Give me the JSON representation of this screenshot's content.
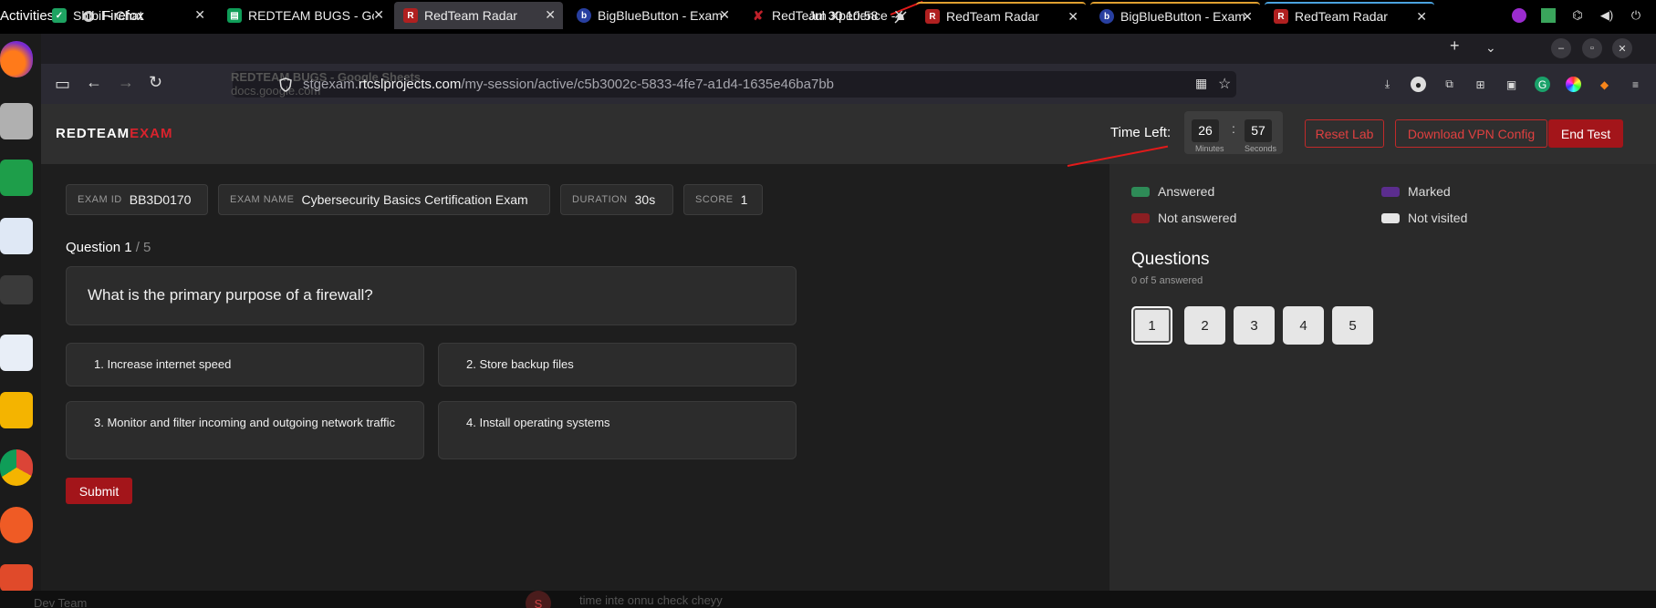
{
  "system": {
    "activities": "Activities",
    "app_name": "Firefox",
    "clock": "Jul 30  10:58"
  },
  "tabs": [
    {
      "title": "Shibil - Chat",
      "icon": "chat-icon",
      "color": "#1ea362"
    },
    {
      "title": "REDTEAM BUGS - Goo",
      "icon": "sheets-icon",
      "color": "#0f9d58"
    },
    {
      "title": "RedTeam Radar",
      "icon": "redteam-icon",
      "color": "#b02020"
    },
    {
      "title": "BigBlueButton - Exam",
      "icon": "bigbluebutton-icon",
      "color": "#283fa0"
    },
    {
      "title": "RedTeam Xperience -",
      "icon": "xperience-icon",
      "color": "#c0202a"
    },
    {
      "title": "RedTeam Radar",
      "icon": "redteam-icon",
      "color": "#b02020"
    },
    {
      "title": "BigBlueButton - Exam",
      "icon": "bigbluebutton-icon",
      "color": "#283fa0"
    },
    {
      "title": "RedTeam Radar",
      "icon": "redteam-icon",
      "color": "#b02020"
    }
  ],
  "address_bar": {
    "url_prefix": "stgexam.",
    "url_domain": "rtcslprojects.com",
    "url_path": "/my-session/active/c5b3002c-5833-4fe7-a1d4-1635e46ba7bb",
    "ghost_title": "REDTEAM BUGS - Google Sheets",
    "ghost_url": "docs.google.com"
  },
  "header": {
    "logo_part1": "REDTEAM",
    "logo_part2": "EXAM",
    "time_left_label": "Time Left:",
    "minutes": "26",
    "seconds": "57",
    "minutes_label": "Minutes",
    "seconds_label": "Seconds",
    "reset_lab": "Reset Lab",
    "download_vpn": "Download VPN Config",
    "end_test": "End Test"
  },
  "exam_info": {
    "exam_id_label": "EXAM ID",
    "exam_id": "BB3D0170",
    "exam_name_label": "EXAM NAME",
    "exam_name": "Cybersecurity Basics Certification Exam",
    "duration_label": "DURATION",
    "duration": "30s",
    "score_label": "SCORE",
    "score": "1"
  },
  "question": {
    "label": "Question 1",
    "total": " / 5",
    "text": "What is the primary purpose of a firewall?",
    "options": [
      "1. Increase internet speed",
      "2. Store backup files",
      "3. Monitor and filter incoming and outgoing network traffic",
      "4. Install operating systems"
    ],
    "submit": "Submit"
  },
  "legend": {
    "answered": "Answered",
    "marked": "Marked",
    "not_answered": "Not answered",
    "not_visited": "Not visited",
    "colors": {
      "answered": "#2e8b57",
      "marked": "#5b2d8e",
      "not_answered": "#8b1e22",
      "not_visited": "#e6e6e6"
    }
  },
  "questions_panel": {
    "title": "Questions",
    "subtitle": "0 of 5 answered",
    "buttons": [
      "1",
      "2",
      "3",
      "4",
      "5"
    ],
    "current": "1"
  },
  "bottom": {
    "left_text": "Dev Team",
    "chat_text": "time inte onnu check cheyy",
    "avatar_letter": "S"
  },
  "colors": {
    "accent_red": "#a3151a",
    "brand_red": "#d9232d"
  }
}
